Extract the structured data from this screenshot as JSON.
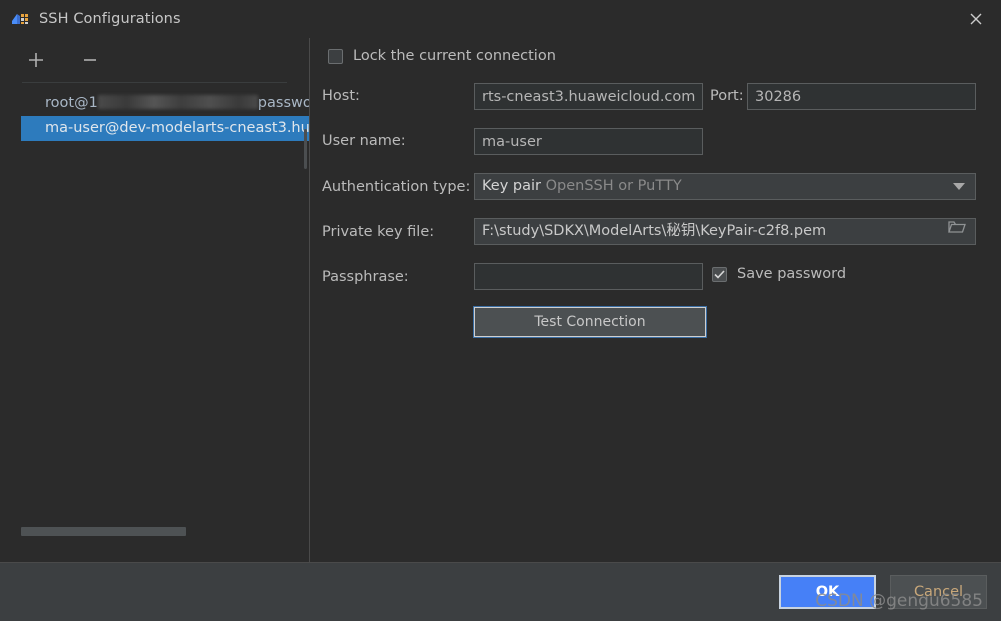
{
  "window": {
    "title": "SSH Configurations",
    "app_icon": "remote-host-icon",
    "close_icon": "close-icon"
  },
  "sidebar": {
    "toolbar": {
      "add_icon": "plus-icon",
      "add_label": "+",
      "remove_icon": "minus-icon",
      "remove_label": "−"
    },
    "items": [
      {
        "label_prefix": "root@1",
        "label_suffix": "password",
        "redacted": true,
        "selected": false
      },
      {
        "label": "ma-user@dev-modelarts-cneast3.hu",
        "redacted": false,
        "selected": true
      }
    ],
    "scrollbar": {
      "h_thumb_name": "horizontal-scrollbar-thumb",
      "v_thumb_name": "vertical-scrollbar-thumb"
    }
  },
  "form": {
    "lock_checkbox": {
      "label": "Lock the current connection",
      "checked": false
    },
    "host": {
      "label": "Host:",
      "value": "rts-cneast3.huaweicloud.com",
      "placeholder": ""
    },
    "port": {
      "label": "Port:",
      "value": "30286",
      "placeholder": ""
    },
    "username": {
      "label": "User name:",
      "value": "ma-user",
      "placeholder": ""
    },
    "auth_type": {
      "label": "Authentication type:",
      "value": "Key pair",
      "value_hint": "OpenSSH or PuTTY",
      "caret_icon": "chevron-down-icon"
    },
    "private_key": {
      "label": "Private key file:",
      "value": "F:\\study\\SDKX\\ModelArts\\秘钥\\KeyPair-c2f8.pem",
      "browse_icon": "folder-icon"
    },
    "passphrase": {
      "label": "Passphrase:",
      "value": "",
      "placeholder": ""
    },
    "save_password": {
      "label": "Save password",
      "checked": true
    },
    "test_connection": {
      "label": "Test Connection"
    }
  },
  "footer": {
    "ok_label": "OK",
    "cancel_label": "Cancel"
  },
  "overlay": {
    "watermark": "CSDN @gengu6585"
  },
  "colors": {
    "dialog_bg": "#3c3f41",
    "panel_bg": "#2b2b2b",
    "selection_blue": "#2d7bbd",
    "ok_blue": "#4680f7",
    "cancel_text": "#c9a87a",
    "field_bg": "#2f3233",
    "border": "#5a5d5e",
    "text": "#bbbbbb"
  }
}
